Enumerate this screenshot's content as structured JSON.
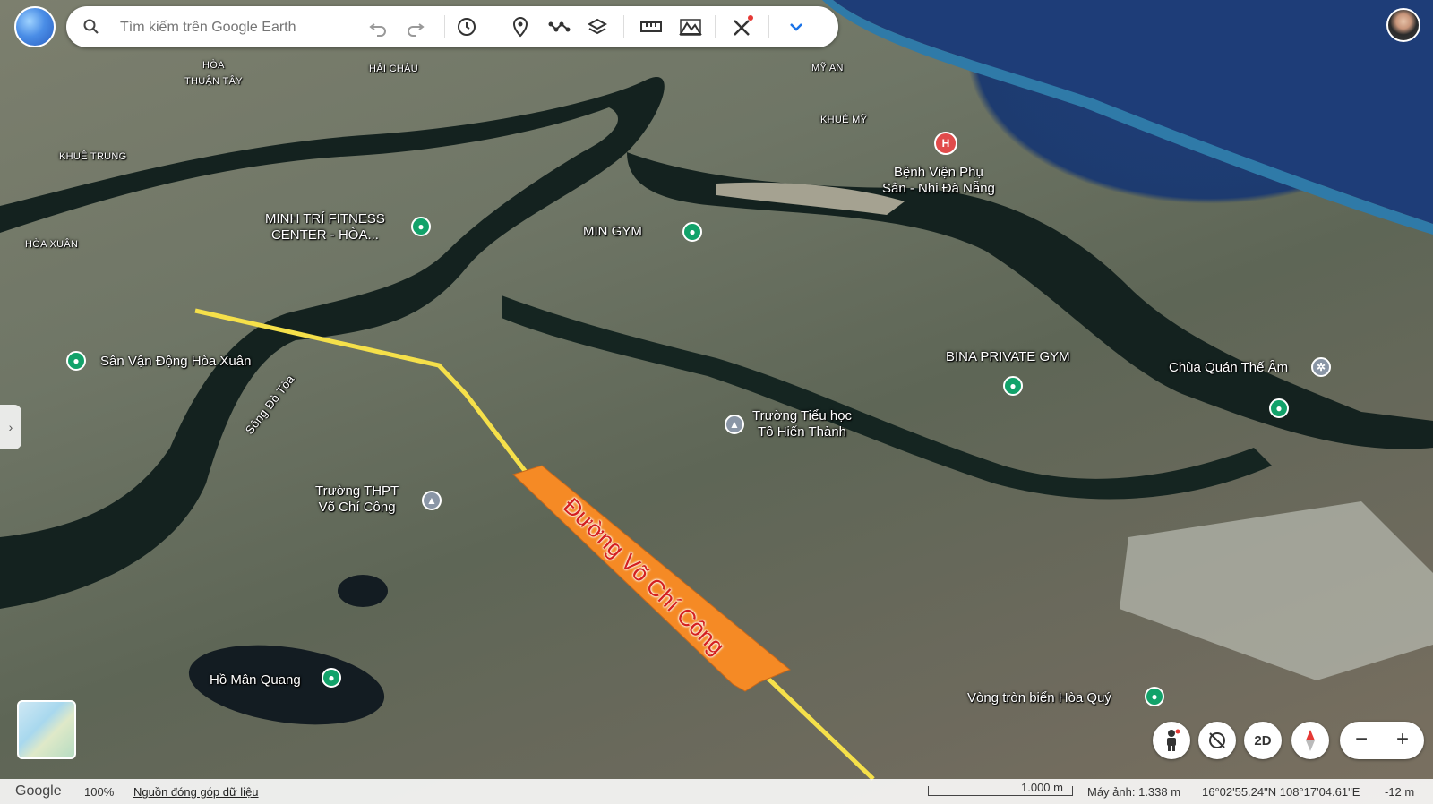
{
  "search": {
    "placeholder": "Tìm kiếm trên Google Earth"
  },
  "map_labels": {
    "hoa_thuan_tay": "HÒA\nTHUẬN TÂY",
    "hai_chau": "HẢI CHÂU",
    "my_an": "MỸ AN",
    "khue_my": "KHUÊ MỸ",
    "khue_trung": "KHUÊ TRUNG",
    "hoa_xuan": "HÒA XUÂN",
    "benh_vien": "Bệnh Viện Phụ\nSản - Nhi Đà Nẵng",
    "minh_tri": "MINH TRÍ FITNESS\nCENTER - HÒA...",
    "min_gym": "MIN GYM",
    "bina": "BINA PRIVATE GYM",
    "chua": "Chùa Quán Thế Âm",
    "san_van_dong": "Sân Vận Động Hòa Xuân",
    "song_do_toa": "Sông Đò Tòa",
    "truong_tieu_hoc": "Trường Tiểu học\nTô Hiến Thành",
    "truong_thpt": "Trường THPT\nVõ Chí Công",
    "ho_man_quang": "Hồ Mân Quang",
    "vong_tron": "Vòng tròn biển Hòa Quý",
    "road_annotation": "Đường Võ Chí Công"
  },
  "controls": {
    "two_d": "2D",
    "zoom_out": "−",
    "zoom_in": "+"
  },
  "footer": {
    "brand": "Google",
    "zoom": "100%",
    "data_link": "Nguồn đóng góp dữ liệu",
    "scale": "1.000 m",
    "camera": "Máy ảnh: 1.338 m",
    "coords": "16°02'55.24\"N 108°17'04.61\"E",
    "elevation": "-12 m"
  },
  "colors": {
    "road_line": "#f5e04a",
    "annotation_fill": "#f58a25",
    "annotation_text": "#d42020",
    "pin_green": "#12a26a"
  }
}
